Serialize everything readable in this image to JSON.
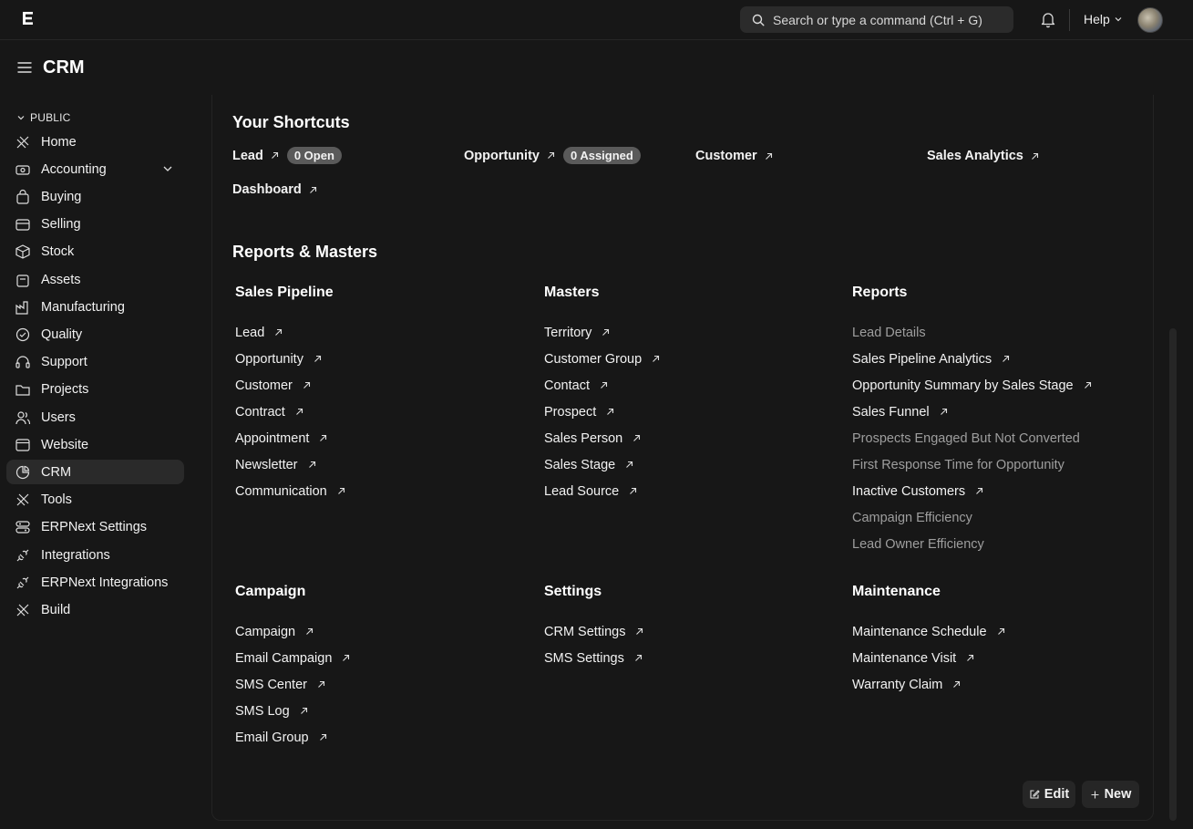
{
  "navbar": {
    "logo": "E",
    "search_placeholder": "Search or type a command (Ctrl + G)",
    "help_label": "Help"
  },
  "page": {
    "title": "CRM"
  },
  "sidebar": {
    "group_label": "PUBLIC",
    "items": [
      {
        "label": "Home",
        "icon": "home-icon"
      },
      {
        "label": "Accounting",
        "icon": "accounting-icon",
        "expandable": true
      },
      {
        "label": "Buying",
        "icon": "buying-icon"
      },
      {
        "label": "Selling",
        "icon": "selling-icon"
      },
      {
        "label": "Stock",
        "icon": "stock-icon"
      },
      {
        "label": "Assets",
        "icon": "assets-icon"
      },
      {
        "label": "Manufacturing",
        "icon": "manufacturing-icon"
      },
      {
        "label": "Quality",
        "icon": "quality-icon"
      },
      {
        "label": "Support",
        "icon": "support-icon"
      },
      {
        "label": "Projects",
        "icon": "projects-icon"
      },
      {
        "label": "Users",
        "icon": "users-icon"
      },
      {
        "label": "Website",
        "icon": "website-icon"
      },
      {
        "label": "CRM",
        "icon": "crm-icon",
        "active": true
      },
      {
        "label": "Tools",
        "icon": "tools-icon"
      },
      {
        "label": "ERPNext Settings",
        "icon": "settings-icon"
      },
      {
        "label": "Integrations",
        "icon": "integrations-icon"
      },
      {
        "label": "ERPNext Integrations",
        "icon": "integrations-icon"
      },
      {
        "label": "Build",
        "icon": "build-icon"
      }
    ]
  },
  "shortcuts": {
    "title": "Your Shortcuts",
    "items": [
      {
        "label": "Lead",
        "badge": "0 Open"
      },
      {
        "label": "Opportunity",
        "badge": "0 Assigned"
      },
      {
        "label": "Customer"
      },
      {
        "label": "Sales Analytics"
      },
      {
        "label": "Dashboard"
      }
    ]
  },
  "reports_masters": {
    "title": "Reports & Masters",
    "cards": [
      {
        "title": "Sales Pipeline",
        "links": [
          {
            "label": "Lead"
          },
          {
            "label": "Opportunity"
          },
          {
            "label": "Customer"
          },
          {
            "label": "Contract"
          },
          {
            "label": "Appointment"
          },
          {
            "label": "Newsletter"
          },
          {
            "label": "Communication"
          }
        ]
      },
      {
        "title": "Masters",
        "links": [
          {
            "label": "Territory"
          },
          {
            "label": "Customer Group"
          },
          {
            "label": "Contact"
          },
          {
            "label": "Prospect"
          },
          {
            "label": "Sales Person"
          },
          {
            "label": "Sales Stage"
          },
          {
            "label": "Lead Source"
          }
        ]
      },
      {
        "title": "Reports",
        "links": [
          {
            "label": "Lead Details",
            "muted": true
          },
          {
            "label": "Sales Pipeline Analytics"
          },
          {
            "label": "Opportunity Summary by Sales Stage"
          },
          {
            "label": "Sales Funnel"
          },
          {
            "label": "Prospects Engaged But Not Converted",
            "muted": true
          },
          {
            "label": "First Response Time for Opportunity",
            "muted": true
          },
          {
            "label": "Inactive Customers"
          },
          {
            "label": "Campaign Efficiency",
            "muted": true
          },
          {
            "label": "Lead Owner Efficiency",
            "muted": true
          }
        ]
      },
      {
        "title": "Campaign",
        "links": [
          {
            "label": "Campaign"
          },
          {
            "label": "Email Campaign"
          },
          {
            "label": "SMS Center"
          },
          {
            "label": "SMS Log"
          },
          {
            "label": "Email Group"
          }
        ]
      },
      {
        "title": "Settings",
        "links": [
          {
            "label": "CRM Settings"
          },
          {
            "label": "SMS Settings"
          }
        ]
      },
      {
        "title": "Maintenance",
        "links": [
          {
            "label": "Maintenance Schedule"
          },
          {
            "label": "Maintenance Visit"
          },
          {
            "label": "Warranty Claim"
          }
        ]
      }
    ]
  },
  "actions": {
    "edit_label": "Edit",
    "new_label": "New"
  }
}
